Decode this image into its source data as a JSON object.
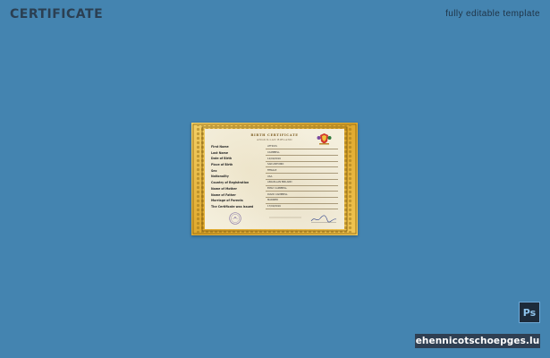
{
  "header": {
    "title": "CERTIFICATE",
    "tagline": "fully editable template"
  },
  "certificate": {
    "title": "BIRTH CERTIFICATE",
    "subtitle": "ANGUILLAN BIRLAND",
    "rows": [
      {
        "label": "First Name",
        "value": "ATTICUS"
      },
      {
        "label": "Last Name",
        "value": "CAMPBELL"
      },
      {
        "label": "Date of Birth",
        "value": "12/09/2016"
      },
      {
        "label": "Place of Birth",
        "value": "SAN ANTONIO"
      },
      {
        "label": "Sex",
        "value": "FEMALE"
      },
      {
        "label": "Nationality",
        "value": "USA"
      },
      {
        "label": "Country of Registration",
        "value": "ANGUILLAN BIRLAND"
      },
      {
        "label": "Name of Mother",
        "value": "EMILY CAMPBELL"
      },
      {
        "label": "Name of Father",
        "value": "DAVID CAMPBELL"
      },
      {
        "label": "Marriage of Parents",
        "value": "MARRIED"
      },
      {
        "label": "The Certificate was issued",
        "value": "17/09/2016"
      }
    ],
    "footer_line1": "",
    "footer_line2": "",
    "colors": {
      "border_gold": "#e2b23c",
      "border_dark": "#8a6410",
      "paper": "#f4efdd",
      "seal": "#8a7aa8"
    }
  },
  "badge": {
    "label": "Ps",
    "icon": "photoshop-icon"
  },
  "watermark": {
    "text": "ehennicotschoepges.lu"
  },
  "colors": {
    "background": "#4484b0",
    "title": "#2b3f52"
  }
}
